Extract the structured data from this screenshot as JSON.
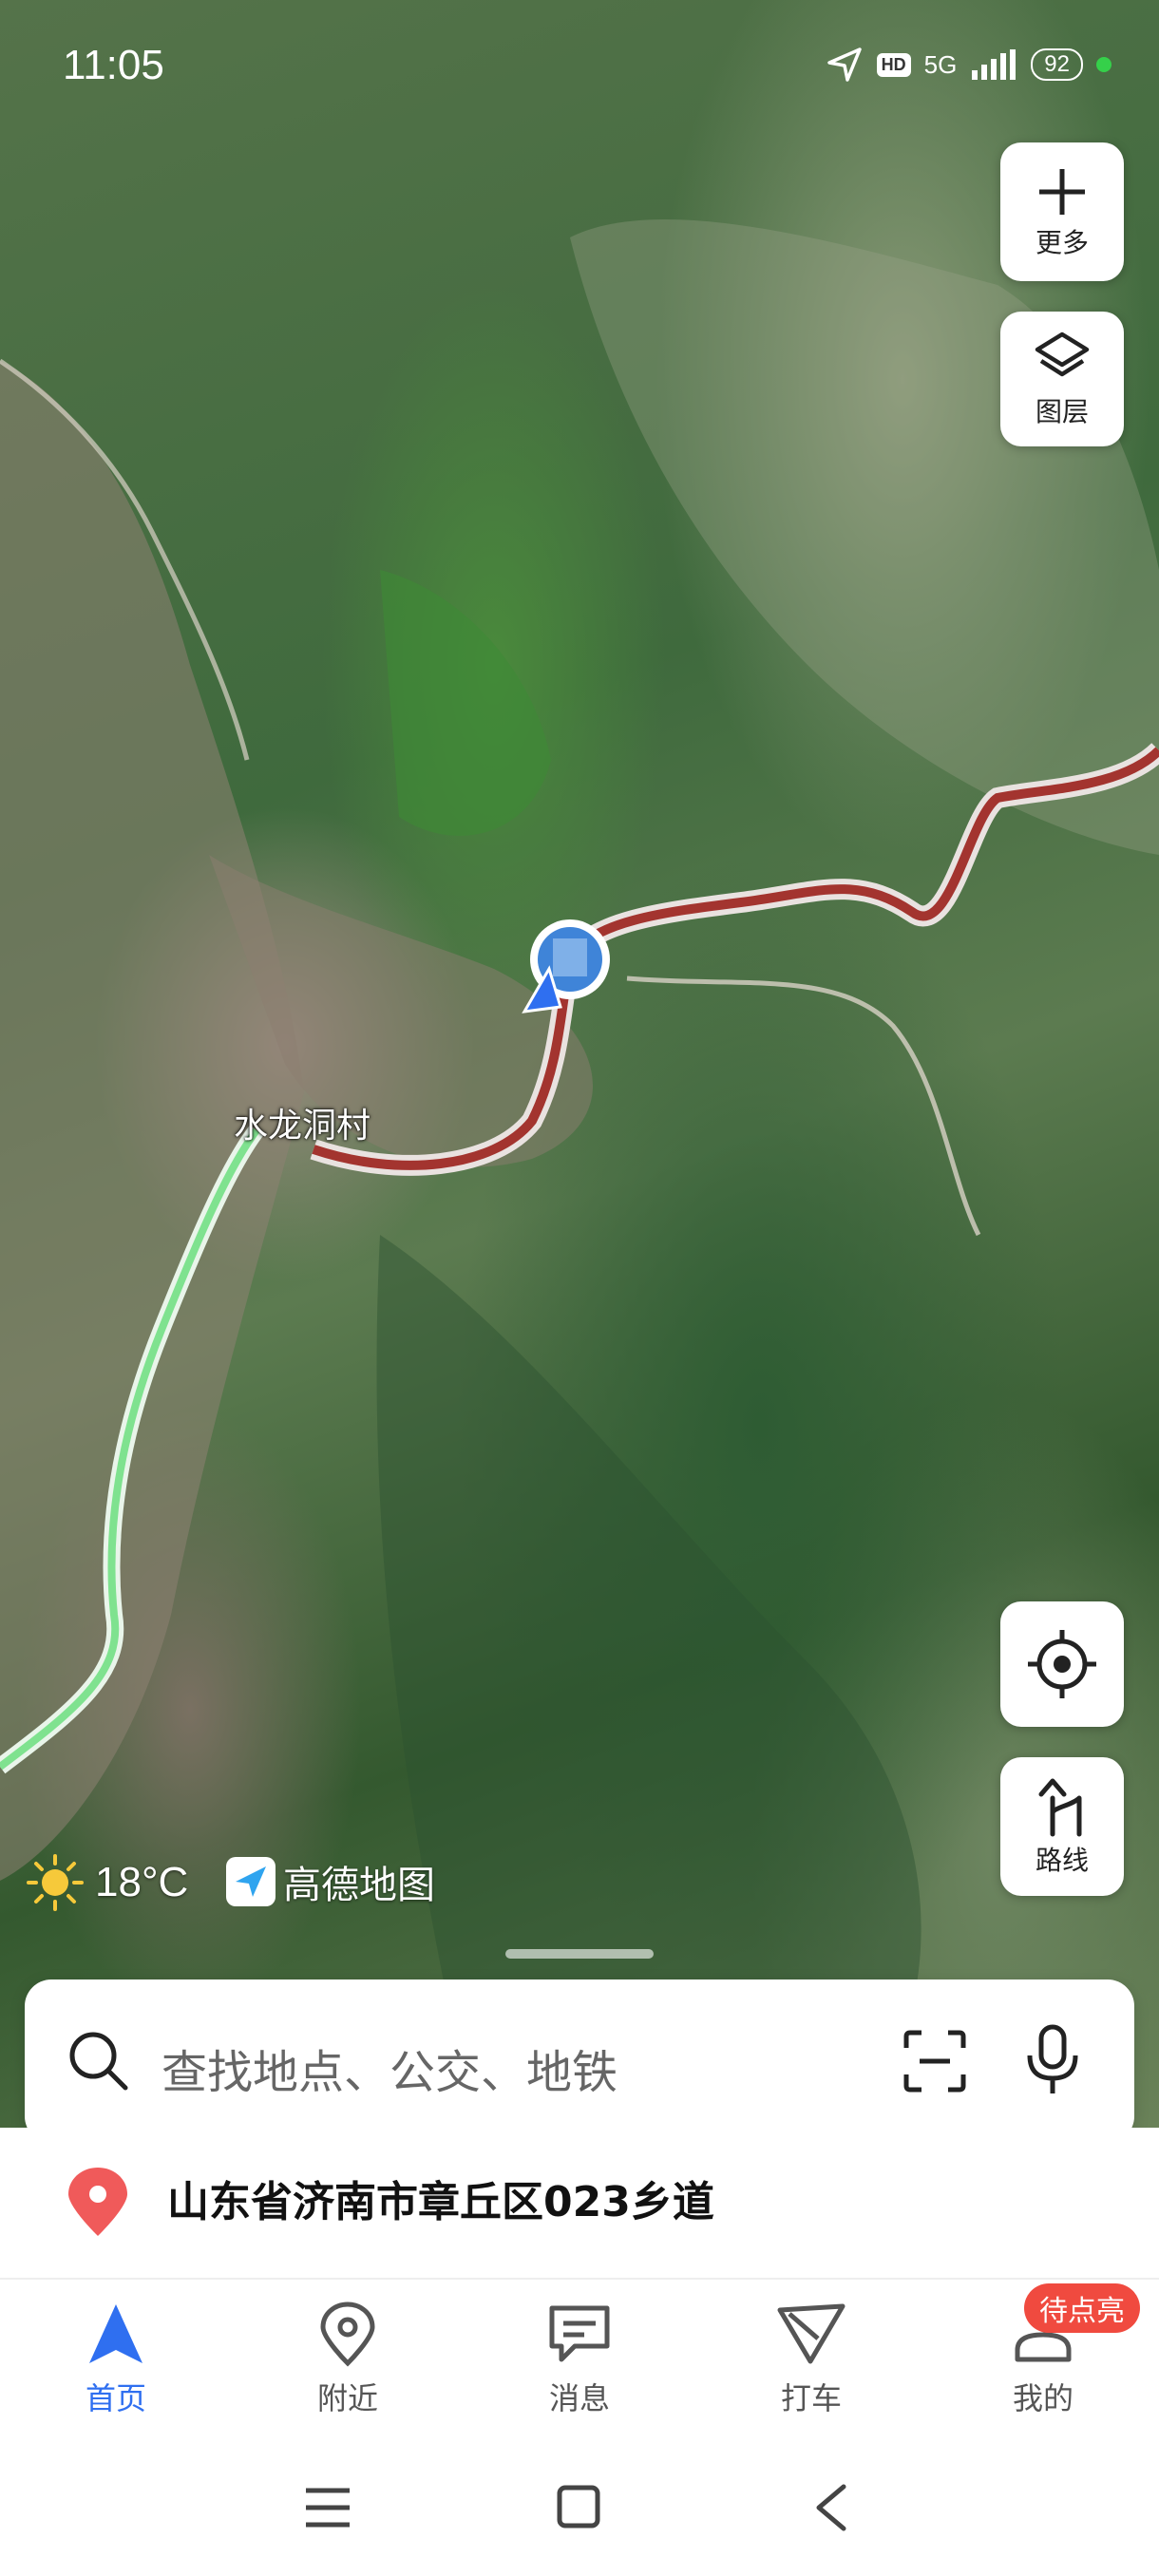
{
  "status_bar": {
    "time": "11:05",
    "hd": "HD",
    "network": "5G",
    "battery": "92"
  },
  "map": {
    "place_label": "水龙洞村",
    "route_color": "#a3342f",
    "alt_route_color": "#7fe28f"
  },
  "side_buttons": {
    "more_label": "更多",
    "layers_label": "图层",
    "route_label": "路线"
  },
  "weather": {
    "temperature": "18°C",
    "brand": "高德地图"
  },
  "search": {
    "placeholder": "查找地点、公交、地铁"
  },
  "location": {
    "address": "山东省济南市章丘区023乡道",
    "pin_color": "#f05a5a"
  },
  "tabs": [
    {
      "label": "首页",
      "icon": "navigation-arrow-icon",
      "active": true
    },
    {
      "label": "附近",
      "icon": "location-pin-icon",
      "active": false
    },
    {
      "label": "消息",
      "icon": "message-icon",
      "active": false
    },
    {
      "label": "打车",
      "icon": "taxi-icon",
      "active": false
    },
    {
      "label": "我的",
      "icon": "profile-icon",
      "active": false
    }
  ],
  "badge": "待点亮",
  "accent_color": "#2f6ff0"
}
